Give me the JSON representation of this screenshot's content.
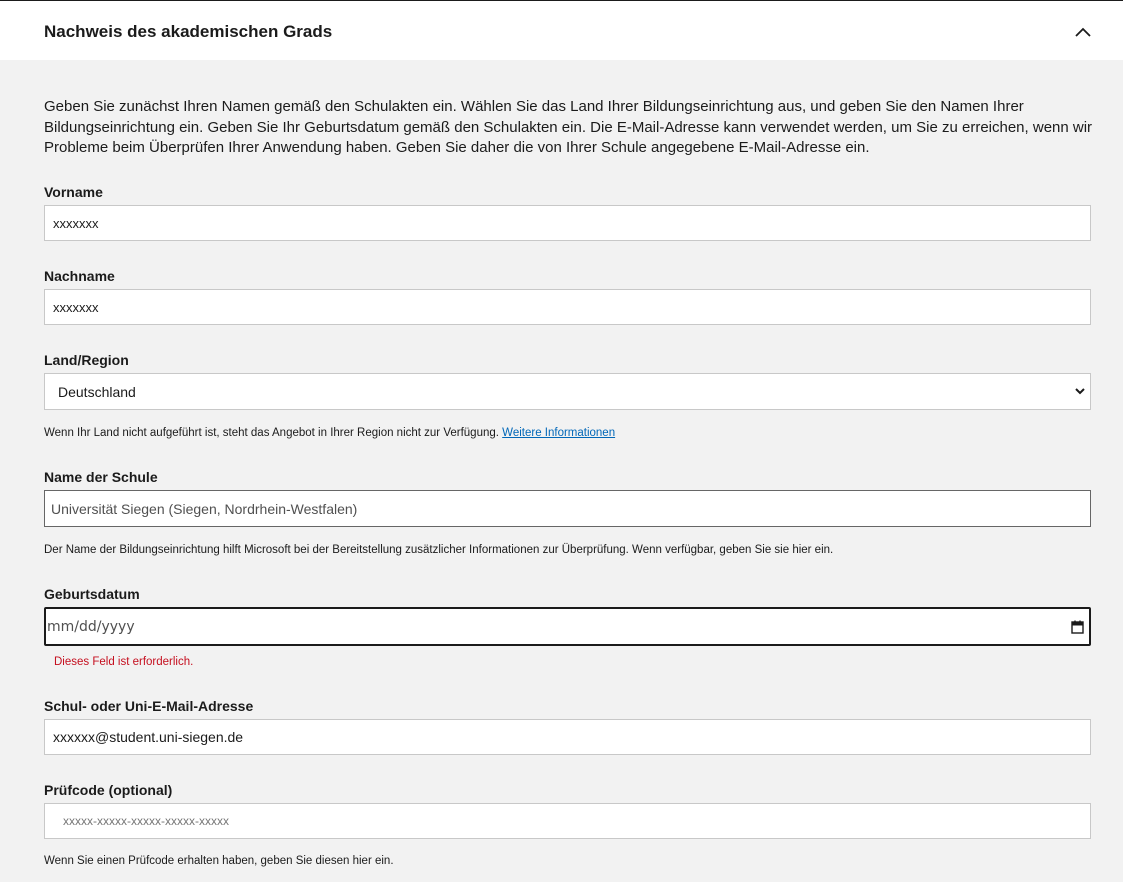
{
  "section": {
    "title": "Nachweis des akademischen Grads",
    "collapse_icon": "chevron-up-icon"
  },
  "intro": "Geben Sie zunächst Ihren Namen gemäß den Schulakten ein. Wählen Sie das Land Ihrer Bildungseinrichtung aus, und geben Sie den Namen Ihrer Bildungseinrichtung ein. Geben Sie Ihr Geburtsdatum gemäß den Schulakten ein. Die E-Mail-Adresse kann verwendet werden, um Sie zu erreichen, wenn wir Probleme beim Überprüfen Ihrer Anwendung haben. Geben Sie daher die von Ihrer Schule angegebene E-Mail-Adresse ein.",
  "form": {
    "first_name": {
      "label": "Vorname",
      "value": "xxxxxxx"
    },
    "last_name": {
      "label": "Nachname",
      "value": "xxxxxxx"
    },
    "country": {
      "label": "Land/Region",
      "selected": "Deutschland",
      "help_text": "Wenn Ihr Land nicht aufgeführt ist, steht das Angebot in Ihrer Region nicht zur Verfügung.",
      "help_link": "Weitere Informationen"
    },
    "school": {
      "label": "Name der Schule",
      "value": "Universität Siegen (Siegen, Nordrhein-Westfalen)",
      "help_text": "Der Name der Bildungseinrichtung hilft Microsoft bei der Bereitstellung zusätzlicher Informationen zur Überprüfung. Wenn verfügbar, geben Sie sie hier ein."
    },
    "birthdate": {
      "label": "Geburtsdatum",
      "placeholder": "mm/dd/yyyy",
      "error": "Dieses Feld ist erforderlich."
    },
    "email": {
      "label": "Schul- oder Uni-E-Mail-Adresse",
      "value": "xxxxxx@student.uni-siegen.de"
    },
    "code": {
      "label": "Prüfcode (optional)",
      "placeholder": "xxxxx-xxxxx-xxxxx-xxxxx-xxxxx",
      "help_text": "Wenn Sie einen Prüfcode erhalten haben, geben Sie diesen hier ein."
    }
  },
  "colors": {
    "link": "#0067b8",
    "error": "#c50f1f",
    "background": "#f2f2f2"
  }
}
